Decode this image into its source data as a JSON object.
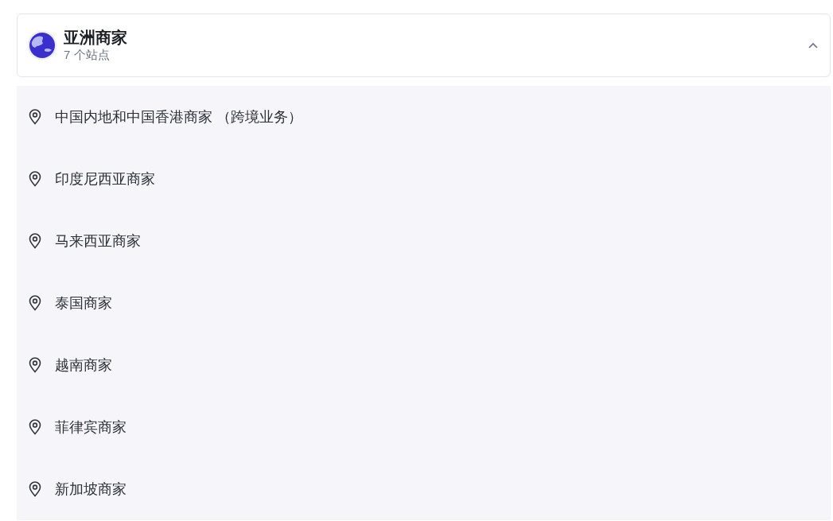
{
  "group": {
    "title": "亚洲商家",
    "subtitle": "7 个站点",
    "expanded": true,
    "sites": [
      {
        "label": "中国内地和中国香港商家 （跨境业务）"
      },
      {
        "label": "印度尼西亚商家"
      },
      {
        "label": "马来西亚商家"
      },
      {
        "label": "泰国商家"
      },
      {
        "label": "越南商家"
      },
      {
        "label": "菲律宾商家"
      },
      {
        "label": "新加坡商家"
      }
    ]
  }
}
